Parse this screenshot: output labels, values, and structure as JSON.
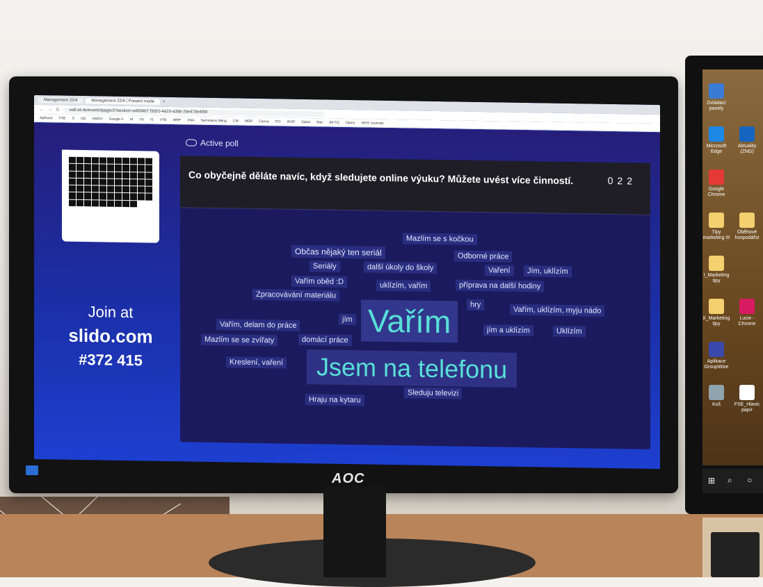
{
  "browser": {
    "tabs": [
      "Management 22/4",
      "Management 22/4 | Present mode"
    ],
    "url": "wall.sli.do/event/4pqgtv3?section=a4894b7 f3d20-4a10-a3bb-2be47de4f88",
    "bookmarks": [
      "Aplikace",
      "FSE",
      "S",
      "GD",
      "OMOV",
      "Google Il.",
      "M",
      "SS",
      "IS",
      "VTB",
      "WRP",
      "XNA",
      "Seminarus Mkng",
      "CM",
      "MDR",
      "Canva",
      "FCI",
      "INSP",
      "Fpbal",
      "Stat",
      "JM FQ",
      "Opory",
      "WOS Journals"
    ]
  },
  "slide": {
    "active_poll_label": "Active poll",
    "question": "Co obyčejně děláte navíc, když sledujete online výuku? Můžete uvést více činností.",
    "response_count": "022",
    "join": {
      "line1": "Join at",
      "line2": "slido.com",
      "line3": "#372 415"
    },
    "word_cloud": {
      "big": [
        "Vařím",
        "Jsem na telefonu"
      ],
      "words": [
        "Mazlím se s kočkou",
        "Občas nějaký ten seriál",
        "Odborné práce",
        "Seriály",
        "další úkoly do školy",
        "Vaření",
        "Jím, uklízím",
        "Vařím oběd :D",
        "uklízím, vařím",
        "příprava na další hodiny",
        "Zpracovávání materiálu",
        "hry",
        "Vařím, uklízím, myju nádo",
        "jím",
        "Vařím, delam do práce",
        "jím a uklízím",
        "Uklízím",
        "Mazlím se se zvířaty",
        "domácí práce",
        "Kreslení, vaření",
        "Sleduju televizi",
        "Hraju na kytaru"
      ]
    }
  },
  "monitor": {
    "brand": "AOC"
  },
  "desktop2": {
    "icons": [
      "Ovládací panely",
      "Microsoft Edge",
      "Google Chrome",
      "Tipy marketing III",
      "I_Marketing tipy",
      "II_Marketing tipy",
      "Aplikace GroupWise",
      "Koš",
      "Aktuality (ZNG)",
      "Oběhové hospodářst",
      "Lucie - Chrome",
      "FSE_Hlavic papír"
    ]
  },
  "colors": {
    "slide_top": "#251f7a",
    "slide_bottom": "#1d3fd0",
    "highlight_word": "#58e0d8"
  }
}
